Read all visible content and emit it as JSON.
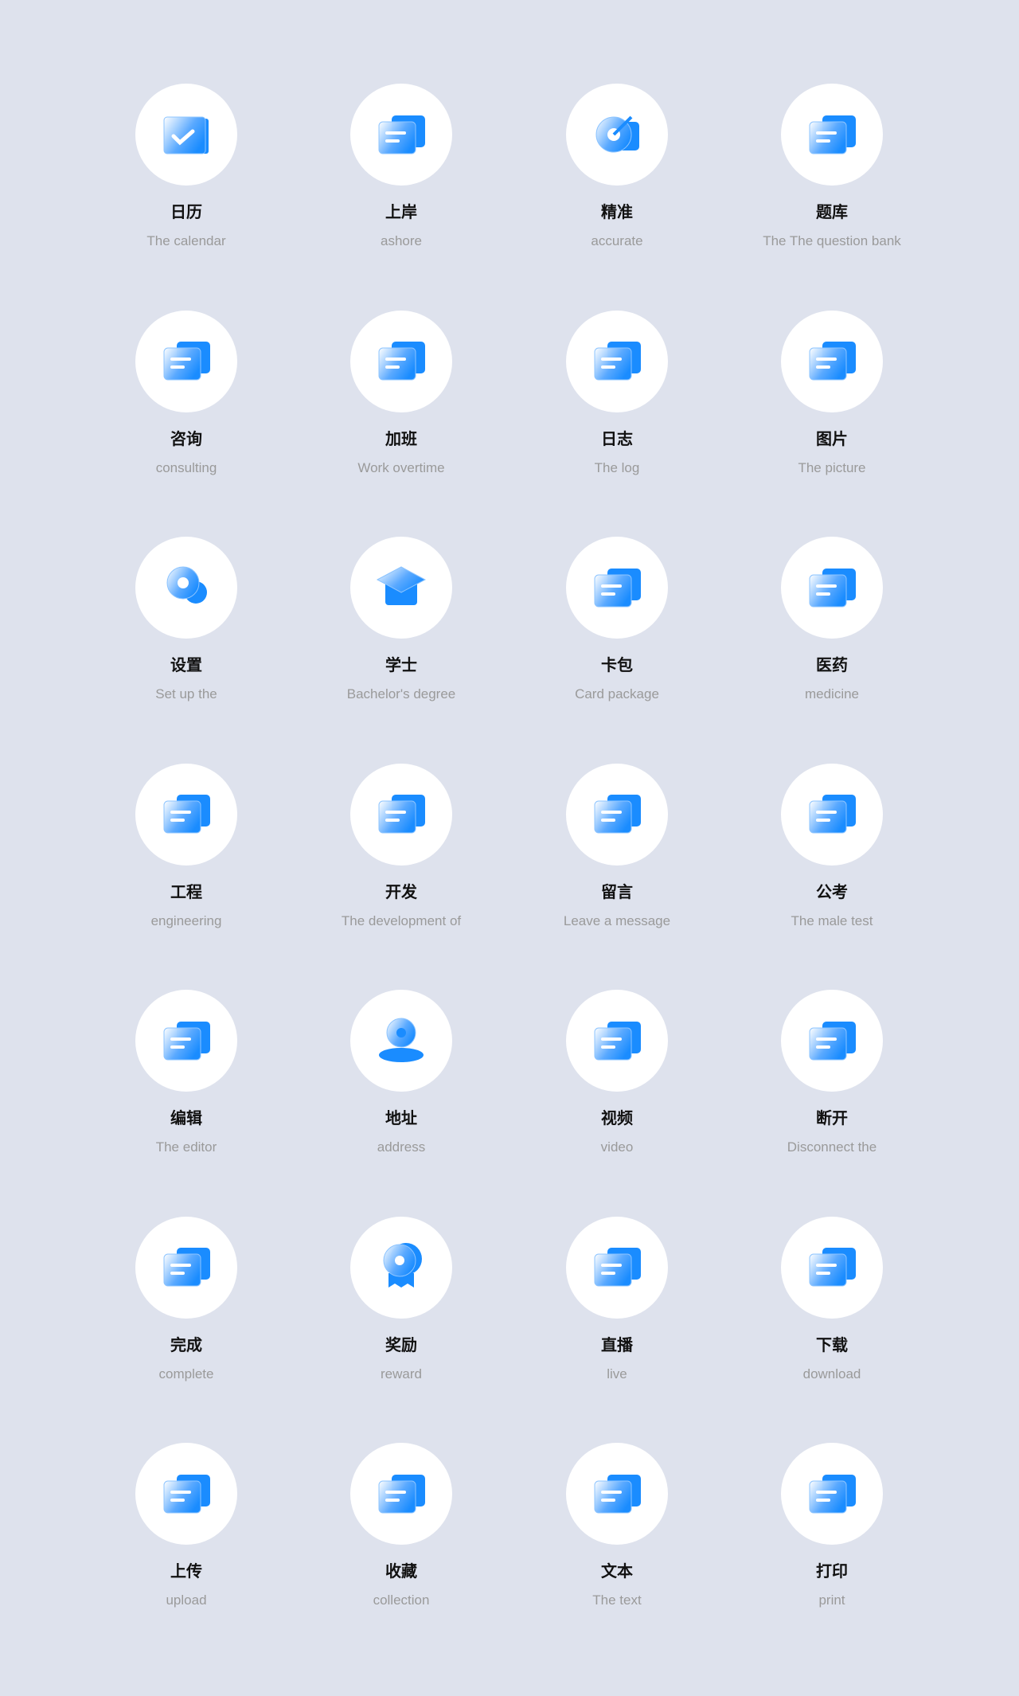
{
  "accent_color": "#1a8cff",
  "items": [
    {
      "title": "日历",
      "subtitle": "The calendar",
      "icon": "calendar-icon"
    },
    {
      "title": "上岸",
      "subtitle": "ashore",
      "icon": "runner-notebook-icon"
    },
    {
      "title": "精准",
      "subtitle": "accurate",
      "icon": "target-icon"
    },
    {
      "title": "题库",
      "subtitle": "The The question bank",
      "icon": "question-bank-icon"
    },
    {
      "title": "咨询",
      "subtitle": "consulting",
      "icon": "chat-bubble-icon"
    },
    {
      "title": "加班",
      "subtitle": "Work overtime",
      "icon": "clock-plus-icon"
    },
    {
      "title": "日志",
      "subtitle": "The log",
      "icon": "log-document-icon"
    },
    {
      "title": "图片",
      "subtitle": "The picture",
      "icon": "picture-icon"
    },
    {
      "title": "设置",
      "subtitle": "Set up the",
      "icon": "gear-icon"
    },
    {
      "title": "学士",
      "subtitle": "Bachelor's degree",
      "icon": "graduation-cap-icon"
    },
    {
      "title": "卡包",
      "subtitle": "Card package",
      "icon": "wallet-icon"
    },
    {
      "title": "医药",
      "subtitle": "medicine",
      "icon": "medical-kit-icon"
    },
    {
      "title": "工程",
      "subtitle": "engineering",
      "icon": "wrench-icon"
    },
    {
      "title": "开发",
      "subtitle": "The development of",
      "icon": "code-window-icon"
    },
    {
      "title": "留言",
      "subtitle": "Leave a message",
      "icon": "message-icon"
    },
    {
      "title": "公考",
      "subtitle": "The male test",
      "icon": "user-card-icon"
    },
    {
      "title": "编辑",
      "subtitle": "The editor",
      "icon": "edit-pen-icon"
    },
    {
      "title": "地址",
      "subtitle": "address",
      "icon": "location-pin-icon"
    },
    {
      "title": "视频",
      "subtitle": "video",
      "icon": "video-camera-icon"
    },
    {
      "title": "断开",
      "subtitle": "Disconnect the",
      "icon": "disconnect-monitor-icon"
    },
    {
      "title": "完成",
      "subtitle": "complete",
      "icon": "check-folder-icon"
    },
    {
      "title": "奖励",
      "subtitle": "reward",
      "icon": "medal-icon"
    },
    {
      "title": "直播",
      "subtitle": "live",
      "icon": "live-play-icon"
    },
    {
      "title": "下载",
      "subtitle": "download",
      "icon": "download-folder-icon"
    },
    {
      "title": "上传",
      "subtitle": "upload",
      "icon": "upload-folder-icon"
    },
    {
      "title": "收藏",
      "subtitle": "collection",
      "icon": "star-folder-icon"
    },
    {
      "title": "文本",
      "subtitle": "The text",
      "icon": "text-document-icon"
    },
    {
      "title": "打印",
      "subtitle": "print",
      "icon": "printer-icon"
    }
  ]
}
